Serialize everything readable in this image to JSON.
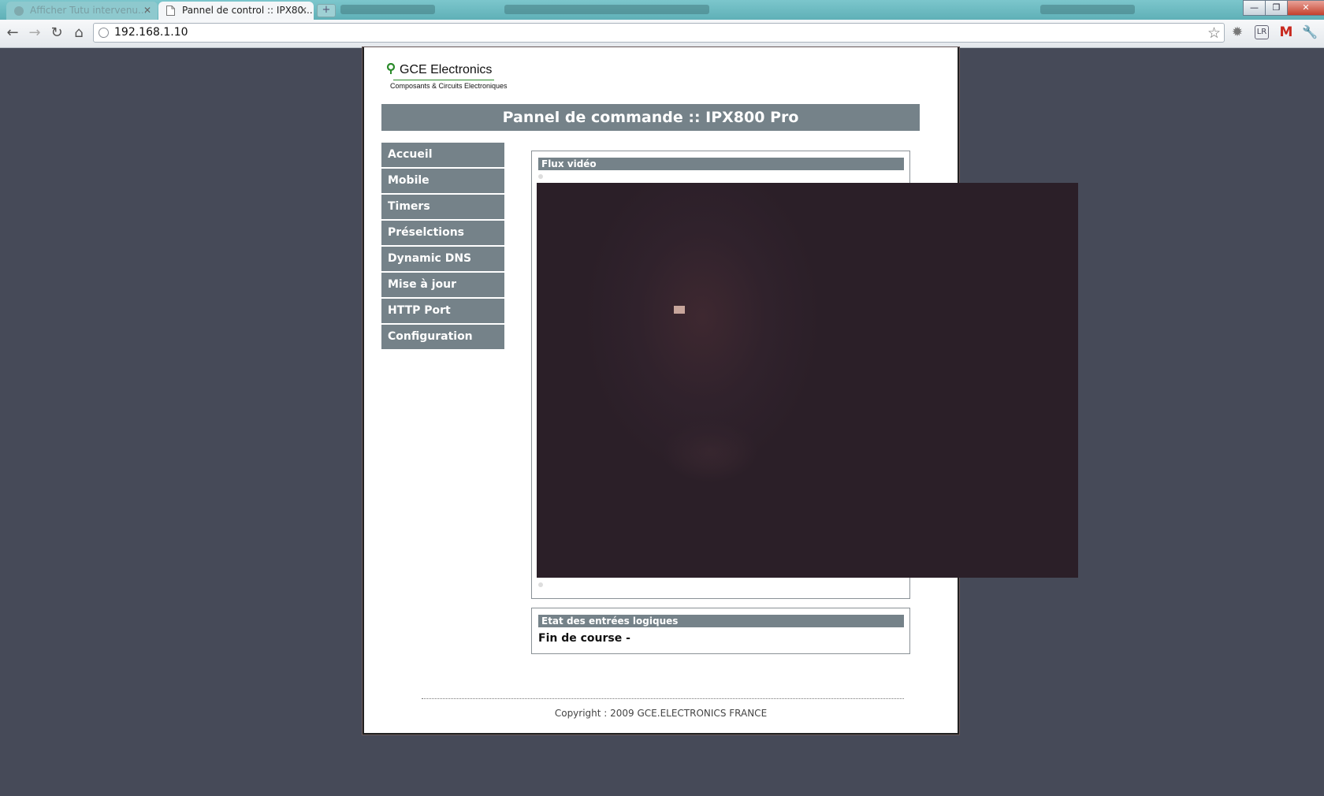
{
  "browser": {
    "tabs": [
      {
        "label": "Afficher Tutu intervenu...",
        "active": false
      },
      {
        "label": "Pannel de control :: IPX80...",
        "active": true
      }
    ],
    "new_tab_symbol": "+",
    "window_buttons": {
      "minimize": "—",
      "restore": "❐",
      "close": "✕"
    },
    "nav": {
      "back": "←",
      "forward": "→",
      "reload": "↻",
      "home": "⌂"
    },
    "url": "192.168.1.10",
    "bookmark_star": "☆",
    "extensions": [
      "gear-icon",
      "lr-icon",
      "gmail-icon",
      "wrench-icon"
    ]
  },
  "site": {
    "logo_name": "GCE Electronics",
    "logo_tagline": "Composants & Circuits Electroniques",
    "banner_title": "Pannel de commande :: IPX800 Pro",
    "menu": [
      "Accueil",
      "Mobile",
      "Timers",
      "Préselctions",
      "Dynamic DNS",
      "Mise à jour",
      "HTTP Port",
      "Configuration"
    ],
    "video_panel_title": "Flux vidéo",
    "inputs_panel_title": "Etat des entrées logiques",
    "inputs_status": "Fin de course -",
    "copyright": "Copyright : 2009 GCE.ELECTRONICS FRANCE"
  },
  "colors": {
    "background": "#464a58",
    "header_bar": "#758289",
    "tab_strip": "#6abac0"
  }
}
